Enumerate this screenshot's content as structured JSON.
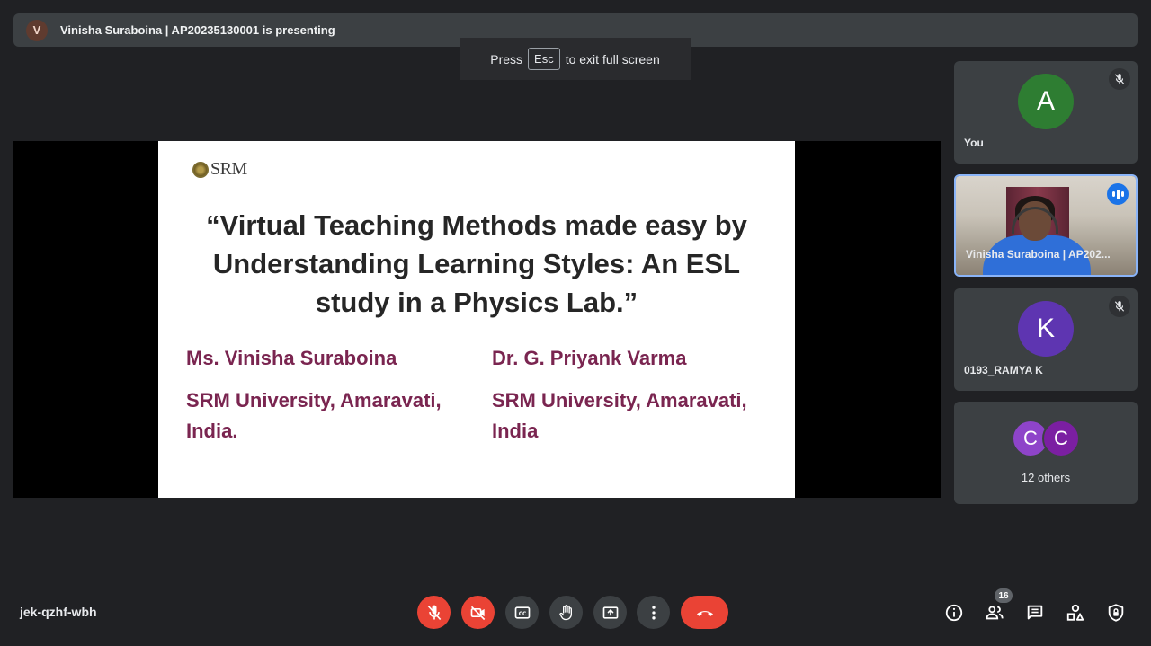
{
  "presenting": {
    "avatar_letter": "V",
    "text": "Vinisha Suraboina | AP20235130001 is presenting"
  },
  "fullscreen_toast": {
    "prefix": "Press",
    "key": "Esc",
    "suffix": "to exit full screen"
  },
  "slide": {
    "logo_text": "SRM",
    "title": "“Virtual Teaching Methods made easy by Understanding Learning Styles: An ESL study in a Physics Lab.”",
    "authors": [
      {
        "name": "Ms. Vinisha Suraboina",
        "affiliation": "SRM University, Amaravati, India."
      },
      {
        "name": "Dr. G. Priyank Varma",
        "affiliation": "SRM University, Amaravati, India"
      }
    ]
  },
  "participants": {
    "you": {
      "letter": "A",
      "name": "You",
      "color": "#2e7d32"
    },
    "vinisha": {
      "name": "Vinisha Suraboina | AP202..."
    },
    "ramya": {
      "letter": "K",
      "name": "0193_RAMYA K",
      "color": "#5e35b1"
    },
    "others": {
      "letters": [
        "C",
        "C"
      ],
      "colors": [
        "#8e44c9",
        "#7b1fa2"
      ],
      "label": "12 others"
    }
  },
  "bottom_bar": {
    "meeting_code": "jek-qzhf-wbh",
    "people_count": "16"
  },
  "colors": {
    "background": "#202124",
    "tile": "#3c4043",
    "danger": "#ea4335",
    "accent": "#8ab4f8",
    "author_text": "#7a2550"
  },
  "icons": {
    "mic": "mic-off-icon",
    "camera": "camera-off-icon",
    "captions": "closed-captions-icon",
    "hand": "raise-hand-icon",
    "present": "present-screen-icon",
    "more": "more-vert-icon",
    "end_call": "end-call-icon",
    "info": "info-icon",
    "people": "people-icon",
    "chat": "chat-icon",
    "activities": "activities-icon",
    "host": "host-controls-icon"
  }
}
